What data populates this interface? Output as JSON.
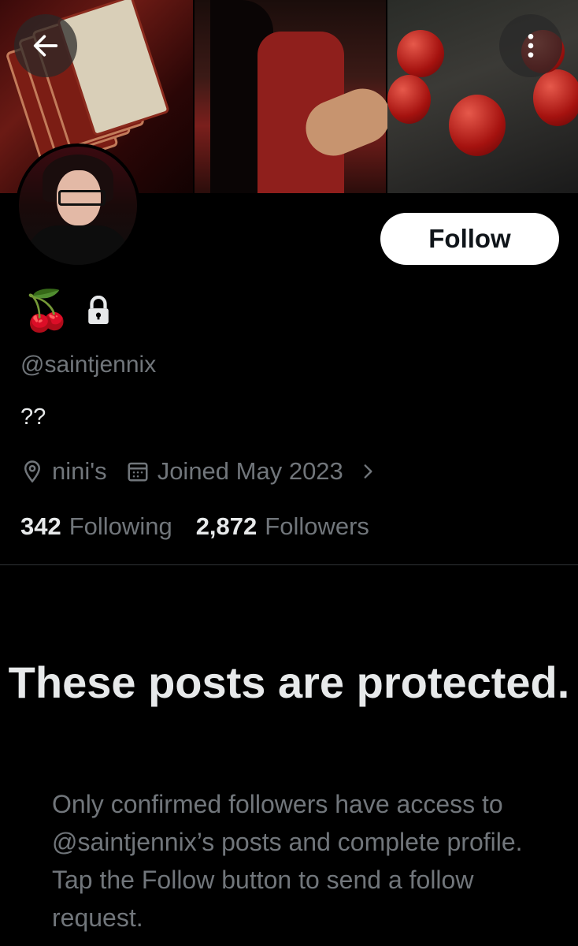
{
  "header": {
    "back_icon": "arrow-left-icon",
    "more_icon": "more-vertical-icon"
  },
  "profile": {
    "name_emoji": "🍒",
    "lock_icon": "lock-icon",
    "handle": "@saintjennix",
    "bio": "??",
    "location": "nini's",
    "joined": "Joined May 2023",
    "following_count": "342",
    "following_label": "Following",
    "followers_count": "2,872",
    "followers_label": "Followers"
  },
  "actions": {
    "follow_label": "Follow"
  },
  "protected": {
    "title": "These posts are protected.",
    "body": "Only confirmed followers have access to @saintjennix’s posts and complete profile. Tap the Follow button to send a follow request."
  },
  "colors": {
    "background": "#000000",
    "text": "#e7e9ea",
    "muted": "#71767b",
    "divider": "#2f3336",
    "button_bg": "#ffffff"
  }
}
